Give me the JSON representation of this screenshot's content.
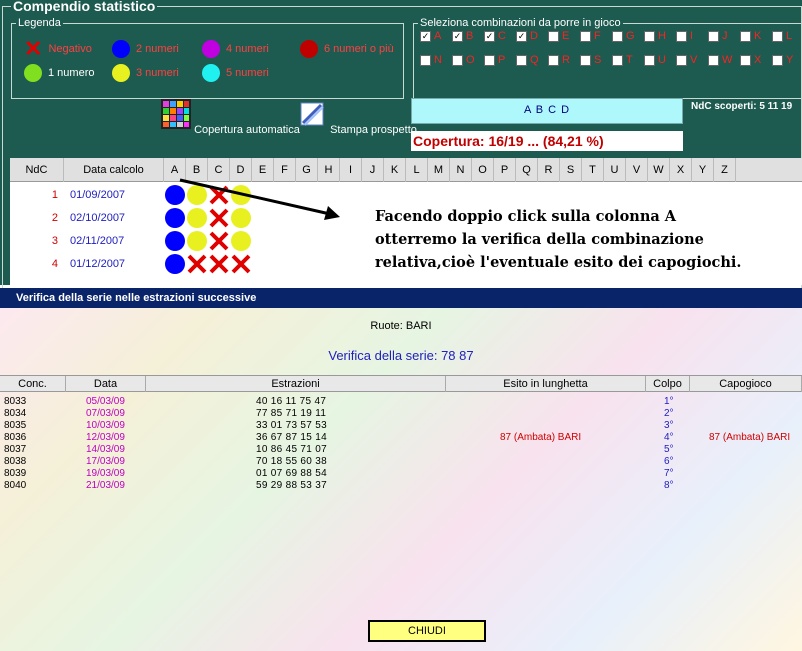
{
  "panel": {
    "title": "Compendio statistico",
    "legend": {
      "title": "Legenda",
      "items": [
        {
          "label": "Negativo",
          "kind": "x",
          "color": "#e00000"
        },
        {
          "label": "2 numeri",
          "kind": "dot",
          "color": "#0000ff"
        },
        {
          "label": "4 numeri",
          "kind": "dot",
          "color": "#c000e0"
        },
        {
          "label": "6 numeri o più",
          "kind": "dot",
          "color": "#c00000"
        },
        {
          "label": "1 numero",
          "kind": "dot",
          "color": "#80e020"
        },
        {
          "label": "3 numeri",
          "kind": "dot",
          "color": "#e8f020"
        },
        {
          "label": "5 numeri",
          "kind": "dot",
          "color": "#20f0f0"
        }
      ]
    },
    "combos": {
      "title": "Seleziona combinazioni da porre in gioco",
      "row1": [
        {
          "label": "A",
          "checked": true
        },
        {
          "label": "B",
          "checked": true
        },
        {
          "label": "C",
          "checked": true
        },
        {
          "label": "D",
          "checked": true
        },
        {
          "label": "E",
          "checked": false
        },
        {
          "label": "F",
          "checked": false
        },
        {
          "label": "G",
          "checked": false
        },
        {
          "label": "H",
          "checked": false
        },
        {
          "label": "I",
          "checked": false
        },
        {
          "label": "J",
          "checked": false
        },
        {
          "label": "K",
          "checked": false
        },
        {
          "label": "L",
          "checked": false
        }
      ],
      "row2": [
        {
          "label": "N",
          "checked": false
        },
        {
          "label": "O",
          "checked": false
        },
        {
          "label": "P",
          "checked": false
        },
        {
          "label": "Q",
          "checked": false
        },
        {
          "label": "R",
          "checked": false
        },
        {
          "label": "S",
          "checked": false
        },
        {
          "label": "T",
          "checked": false
        },
        {
          "label": "U",
          "checked": false
        },
        {
          "label": "V",
          "checked": false
        },
        {
          "label": "W",
          "checked": false
        },
        {
          "label": "X",
          "checked": false
        },
        {
          "label": "Y",
          "checked": false
        }
      ]
    },
    "buttons": {
      "auto": "Copertura automatica",
      "print": "Stampa prospetto"
    },
    "selected_combo": "A B C D",
    "ndc_scoperti": "NdC scoperti: 5 11 19",
    "copertura": "Copertura: 16/19 ... (84,21 %)",
    "grid": {
      "headers": [
        "NdC",
        "Data calcolo",
        "A",
        "B",
        "C",
        "D",
        "E",
        "F",
        "G",
        "H",
        "I",
        "J",
        "K",
        "L",
        "M",
        "N",
        "O",
        "P",
        "Q",
        "R",
        "S",
        "T",
        "U",
        "V",
        "W",
        "X",
        "Y",
        "Z"
      ],
      "rows": [
        {
          "n": "1",
          "date": "01/09/2007",
          "cells": [
            "blue",
            "yellow",
            "x",
            "yellow"
          ]
        },
        {
          "n": "2",
          "date": "02/10/2007",
          "cells": [
            "blue",
            "yellow",
            "x",
            "yellow"
          ]
        },
        {
          "n": "3",
          "date": "02/11/2007",
          "cells": [
            "blue",
            "yellow",
            "x",
            "yellow"
          ]
        },
        {
          "n": "4",
          "date": "01/12/2007",
          "cells": [
            "blue",
            "x",
            "x",
            "x"
          ]
        }
      ]
    },
    "annotation": "Facendo doppio click sulla colonna A otterremo la verifica della combinazione relativa,cioè l'eventuale esito dei capogiochi."
  },
  "window": {
    "title": "Verifica della serie nelle estrazioni successive",
    "ruote": "Ruote: BARI",
    "verifica": "Verifica della serie: 78 87",
    "headers": [
      "Conc.",
      "Data",
      "Estrazioni",
      "Esito in lunghetta",
      "Colpo",
      "Capogioco"
    ],
    "rows": [
      {
        "conc": "8033",
        "data": "05/03/09",
        "estr": "40 16 11 75 47",
        "esito": "",
        "colpo": "1°",
        "capo": ""
      },
      {
        "conc": "8034",
        "data": "07/03/09",
        "estr": "77 85 71 19 11",
        "esito": "",
        "colpo": "2°",
        "capo": ""
      },
      {
        "conc": "8035",
        "data": "10/03/09",
        "estr": "33 01 73 57 53",
        "esito": "",
        "colpo": "3°",
        "capo": ""
      },
      {
        "conc": "8036",
        "data": "12/03/09",
        "estr": "36 67 87 15 14",
        "esito": "87   (Ambata) BARI",
        "colpo": "4°",
        "capo": "87   (Ambata) BARI"
      },
      {
        "conc": "8037",
        "data": "14/03/09",
        "estr": "10 86 45 71 07",
        "esito": "",
        "colpo": "5°",
        "capo": ""
      },
      {
        "conc": "8038",
        "data": "17/03/09",
        "estr": "70 18 55 60 38",
        "esito": "",
        "colpo": "6°",
        "capo": ""
      },
      {
        "conc": "8039",
        "data": "19/03/09",
        "estr": "01 07 69 88 54",
        "esito": "",
        "colpo": "7°",
        "capo": ""
      },
      {
        "conc": "8040",
        "data": "21/03/09",
        "estr": "59 29 88 53 37",
        "esito": "",
        "colpo": "8°",
        "capo": ""
      }
    ],
    "close": "CHIUDI"
  }
}
